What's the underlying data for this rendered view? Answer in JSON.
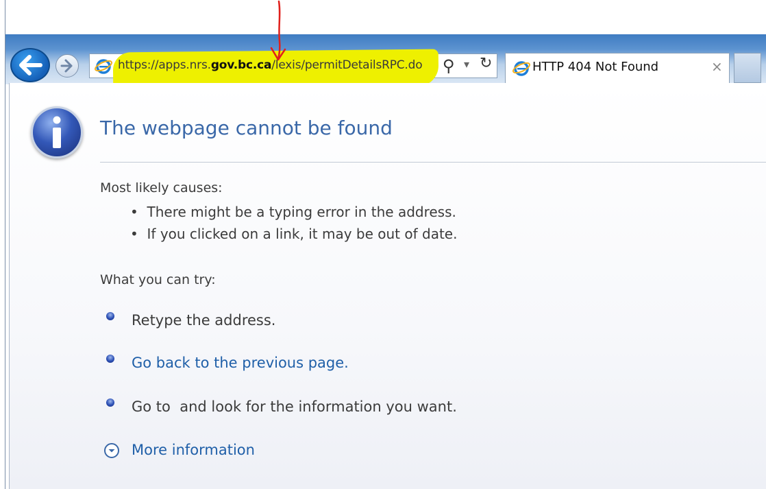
{
  "browser": {
    "address_url_prefix": "https://apps.nrs.",
    "address_url_bold": "gov.bc.ca",
    "address_url_suffix": "/lexis/permitDetailsRPC.do",
    "search_glyph": "⚲",
    "dropdown_glyph": "▾",
    "refresh_glyph": "↻",
    "tab_title": "HTTP 404 Not Found",
    "tab_close": "×"
  },
  "page": {
    "title": "The webpage cannot be found",
    "causes_heading": "Most likely causes:",
    "causes": [
      "There might be a typing error in the address.",
      "If you clicked on a link, it may be out of date."
    ],
    "try_heading": "What you can try:",
    "actions": [
      "Retype the address.",
      "Go back to the previous page.",
      "Go to  and look for the information you want."
    ],
    "more_info": "More information"
  },
  "colors": {
    "highlight": "#eef000",
    "annotation_arrow": "#e0201c",
    "title": "#3a68a8",
    "link": "#1f5fa8"
  },
  "icons": {
    "back": "arrow-left-icon",
    "forward": "arrow-right-icon",
    "ie": "internet-explorer-icon",
    "info": "info-icon",
    "bullet": "bullet-icon",
    "more": "chevron-down-circle-icon"
  }
}
